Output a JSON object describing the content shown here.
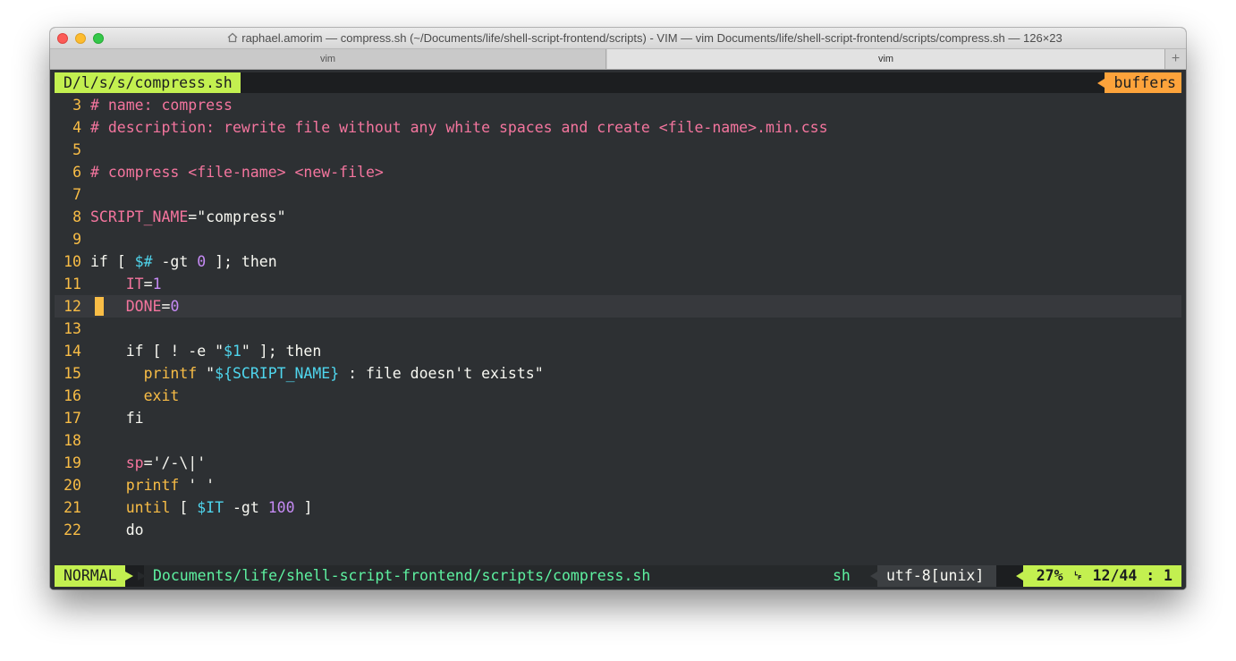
{
  "window": {
    "title": "raphael.amorim — compress.sh (~/Documents/life/shell-script-frontend/scripts) - VIM — vim Documents/life/shell-script-frontend/scripts/compress.sh — 126×23",
    "tabs": [
      "vim",
      "vim"
    ],
    "new_tab_label": "+"
  },
  "vim": {
    "tabline_file": "D/l/s/s/compress.sh",
    "tabline_buffers": "buffers",
    "lines": [
      {
        "n": "3",
        "segments": [
          {
            "t": "# name: compress",
            "c": "com"
          }
        ]
      },
      {
        "n": "4",
        "segments": [
          {
            "t": "# description: rewrite file without any white spaces and create <file-name>.min.css",
            "c": "com"
          }
        ]
      },
      {
        "n": "5",
        "segments": []
      },
      {
        "n": "6",
        "segments": [
          {
            "t": "# compress <file-name> <new-file>",
            "c": "com"
          }
        ]
      },
      {
        "n": "7",
        "segments": []
      },
      {
        "n": "8",
        "segments": [
          {
            "t": "SCRIPT_NAME",
            "c": "var"
          },
          {
            "t": "=\"compress\"",
            "c": "plain"
          }
        ]
      },
      {
        "n": "9",
        "segments": []
      },
      {
        "n": "10",
        "segments": [
          {
            "t": "if [ ",
            "c": "plain"
          },
          {
            "t": "$#",
            "c": "spec"
          },
          {
            "t": " -gt ",
            "c": "plain"
          },
          {
            "t": "0",
            "c": "num"
          },
          {
            "t": " ]; then",
            "c": "plain"
          }
        ]
      },
      {
        "n": "11",
        "segments": [
          {
            "t": "    ",
            "c": "plain"
          },
          {
            "t": "IT",
            "c": "var"
          },
          {
            "t": "=",
            "c": "plain"
          },
          {
            "t": "1",
            "c": "num"
          }
        ]
      },
      {
        "n": "12",
        "current": true,
        "segments": [
          {
            "t": "    ",
            "c": "plain"
          },
          {
            "t": "DONE",
            "c": "var"
          },
          {
            "t": "=",
            "c": "plain"
          },
          {
            "t": "0",
            "c": "num"
          }
        ]
      },
      {
        "n": "13",
        "segments": []
      },
      {
        "n": "14",
        "segments": [
          {
            "t": "    if [ ! -e \"",
            "c": "plain"
          },
          {
            "t": "$1",
            "c": "spec"
          },
          {
            "t": "\" ]; then",
            "c": "plain"
          }
        ]
      },
      {
        "n": "15",
        "segments": [
          {
            "t": "      ",
            "c": "plain"
          },
          {
            "t": "printf",
            "c": "kw"
          },
          {
            "t": " \"",
            "c": "plain"
          },
          {
            "t": "${SCRIPT_NAME}",
            "c": "spec"
          },
          {
            "t": " : file doesn't exists\"",
            "c": "plain"
          }
        ]
      },
      {
        "n": "16",
        "segments": [
          {
            "t": "      ",
            "c": "plain"
          },
          {
            "t": "exit",
            "c": "kw"
          }
        ]
      },
      {
        "n": "17",
        "segments": [
          {
            "t": "    fi",
            "c": "plain"
          }
        ]
      },
      {
        "n": "18",
        "segments": []
      },
      {
        "n": "19",
        "segments": [
          {
            "t": "    ",
            "c": "plain"
          },
          {
            "t": "sp",
            "c": "var"
          },
          {
            "t": "='/-\\|'",
            "c": "plain"
          }
        ]
      },
      {
        "n": "20",
        "segments": [
          {
            "t": "    ",
            "c": "plain"
          },
          {
            "t": "printf",
            "c": "kw"
          },
          {
            "t": " ' '",
            "c": "plain"
          }
        ]
      },
      {
        "n": "21",
        "segments": [
          {
            "t": "    ",
            "c": "plain"
          },
          {
            "t": "until",
            "c": "kw"
          },
          {
            "t": " [ ",
            "c": "plain"
          },
          {
            "t": "$IT",
            "c": "spec"
          },
          {
            "t": " -gt ",
            "c": "plain"
          },
          {
            "t": "100",
            "c": "num"
          },
          {
            "t": " ]",
            "c": "plain"
          }
        ]
      },
      {
        "n": "22",
        "segments": [
          {
            "t": "    do",
            "c": "plain"
          }
        ]
      }
    ],
    "statusline": {
      "mode": "NORMAL",
      "path": "Documents/life/shell-script-frontend/scripts/compress.sh",
      "filetype": "sh",
      "encoding": "utf-8[unix]",
      "position": "27% ␊  12/44 :  1"
    }
  }
}
